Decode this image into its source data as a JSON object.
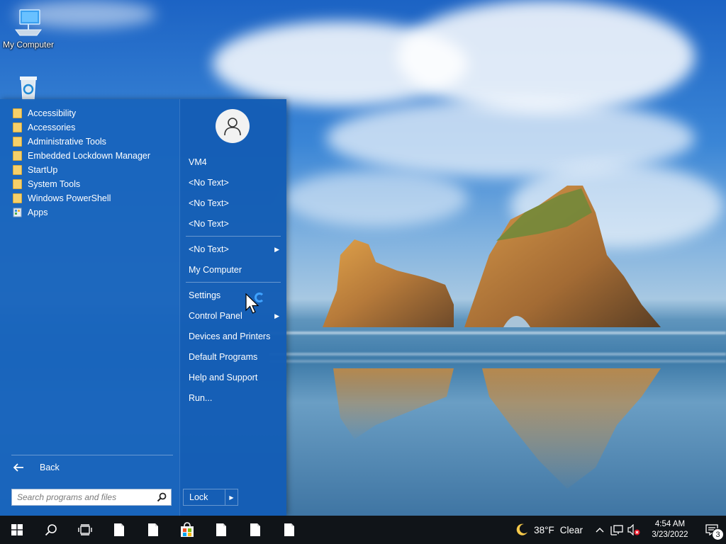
{
  "desktop": {
    "icons": [
      {
        "label": "My Computer",
        "icon": "computer-icon"
      },
      {
        "label": "Recycle Bin",
        "icon": "recycle-bin-icon"
      }
    ]
  },
  "start_menu": {
    "programs": [
      {
        "label": "Accessibility",
        "icon": "folder-icon"
      },
      {
        "label": "Accessories",
        "icon": "folder-icon"
      },
      {
        "label": "Administrative Tools",
        "icon": "folder-icon"
      },
      {
        "label": "Embedded Lockdown Manager",
        "icon": "folder-icon"
      },
      {
        "label": "StartUp",
        "icon": "folder-icon"
      },
      {
        "label": "System Tools",
        "icon": "folder-icon"
      },
      {
        "label": "Windows PowerShell",
        "icon": "folder-icon"
      },
      {
        "label": "Apps",
        "icon": "apps-icon"
      }
    ],
    "back_label": "Back",
    "search_placeholder": "Search programs and files",
    "user_name": "VM4",
    "right_items": [
      {
        "label": "<No Text>",
        "submenu": false
      },
      {
        "label": "<No Text>",
        "submenu": false
      },
      {
        "label": "<No Text>",
        "submenu": false
      },
      {
        "label": "<No Text>",
        "submenu": true
      },
      {
        "label": "My Computer",
        "submenu": false
      },
      {
        "label": "Settings",
        "submenu": false
      },
      {
        "label": "Control Panel",
        "submenu": true
      },
      {
        "label": "Devices and Printers",
        "submenu": false
      },
      {
        "label": "Default Programs",
        "submenu": false
      },
      {
        "label": "Help and Support",
        "submenu": false
      },
      {
        "label": "Run...",
        "submenu": false
      }
    ],
    "lock_label": "Lock"
  },
  "taskbar": {
    "weather_temp": "38°F",
    "weather_condition": "Clear",
    "time": "4:54 AM",
    "date": "3/23/2022",
    "notification_count": "3"
  },
  "colors": {
    "menu_bg": "#1864bc",
    "taskbar_bg": "#101418",
    "folder": "#f6d06a",
    "accent": "#3fa2ff"
  }
}
